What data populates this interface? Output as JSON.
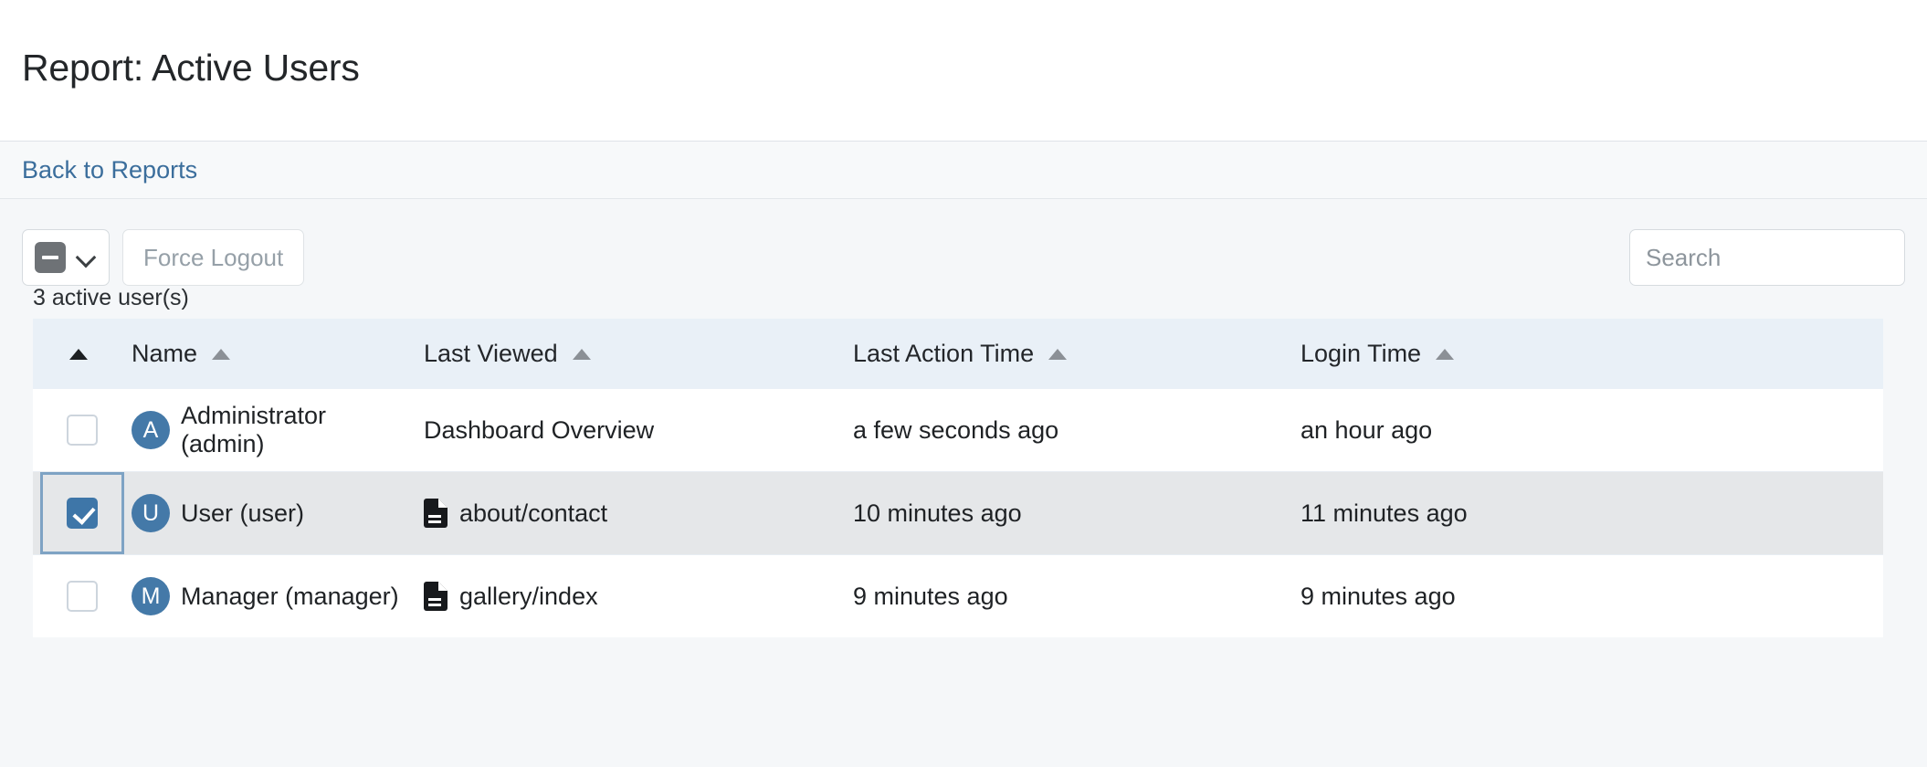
{
  "header": {
    "title": "Report: Active Users",
    "back_link": "Back to Reports"
  },
  "toolbar": {
    "select_all_icon": "indeterminate-checkbox-icon",
    "select_all_chevron_icon": "chevron-down-icon",
    "force_logout_label": "Force Logout",
    "search_placeholder": "Search",
    "search_value": ""
  },
  "table": {
    "count_label": "3 active user(s)",
    "columns": [
      {
        "label": "",
        "sort_icon": "sort-ascending-icon",
        "active": true
      },
      {
        "label": "Name",
        "sort_icon": "sort-ascending-icon",
        "active": false
      },
      {
        "label": "Last Viewed",
        "sort_icon": "sort-ascending-icon",
        "active": false
      },
      {
        "label": "Last Action Time",
        "sort_icon": "sort-ascending-icon",
        "active": false
      },
      {
        "label": "Login Time",
        "sort_icon": "sort-ascending-icon",
        "active": false
      }
    ],
    "rows": [
      {
        "checked": false,
        "avatar_initial": "A",
        "name": "Administrator (admin)",
        "last_viewed": "Dashboard Overview",
        "last_viewed_icon": "",
        "last_action_time": "a few seconds ago",
        "login_time": "an hour ago"
      },
      {
        "checked": true,
        "avatar_initial": "U",
        "name": "User (user)",
        "last_viewed": "about/contact",
        "last_viewed_icon": "document-icon",
        "last_action_time": "10 minutes ago",
        "login_time": "11 minutes ago"
      },
      {
        "checked": false,
        "avatar_initial": "M",
        "name": "Manager (manager)",
        "last_viewed": "gallery/index",
        "last_viewed_icon": "document-icon",
        "last_action_time": "9 minutes ago",
        "login_time": "9 minutes ago"
      }
    ]
  },
  "colors": {
    "link": "#3b6e9c",
    "avatar": "#4479a8",
    "checkbox_checked": "#3e76a8",
    "header_row": "#e9f0f7",
    "selected_row": "#e5e7e9",
    "page_background": "#f5f7f9"
  }
}
